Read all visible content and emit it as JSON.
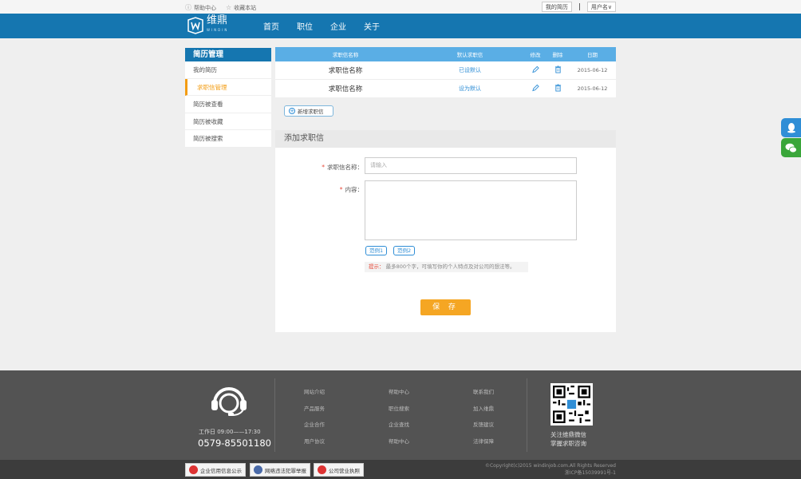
{
  "topbar": {
    "help": "帮助中心",
    "favorite": "收藏本站",
    "my_resume": "我的简历",
    "divider": "|",
    "user_menu": "用户名∨"
  },
  "header": {
    "logo_text": "维鼎",
    "logo_sub": "WINDIN",
    "nav": [
      "首页",
      "职位",
      "企业",
      "关于"
    ]
  },
  "sidebar": {
    "title": "简历管理",
    "items": [
      "我的简历",
      "求职信管理",
      "简历被查看",
      "简历被收藏",
      "简历被搜索"
    ],
    "active_index": 1
  },
  "table": {
    "headers": [
      "求职信名称",
      "默认求职信",
      "修改",
      "删除",
      "日期"
    ],
    "rows": [
      {
        "name": "求职信名称",
        "status": "已设默认",
        "date": "2015-06-12"
      },
      {
        "name": "求职信名称",
        "status": "设为默认",
        "date": "2015-06-12"
      }
    ]
  },
  "add_button": "新增求职信",
  "form": {
    "title": "添加求职信",
    "name_label": "求职信名称：",
    "name_placeholder": "请输入",
    "content_label": "内容：",
    "required_mark": "*",
    "example1": "范例1",
    "example2": "范例2",
    "tip_key": "提示：",
    "tip_text": "最多800个字，可填写你的个人特点及对公司的想法等。",
    "save": "保 存"
  },
  "footer": {
    "work_hours": "工作日  09:00——17:30",
    "phone": "0579-85501180",
    "links": [
      [
        "网站介绍",
        "产品服务",
        "企业合作",
        "用户协议"
      ],
      [
        "帮助中心",
        "职位搜索",
        "企业查找",
        "帮助中心"
      ],
      [
        "联系我们",
        "加入维鼎",
        "反馈建议",
        "法律保障"
      ]
    ],
    "qr_caption_1": "关注维鼎微信",
    "qr_caption_2": "掌握求职咨询",
    "badges": [
      "企业信用信息公示",
      "网络违法犯罪举报",
      "公司营业执照"
    ],
    "copyright": "©Copyright(c)2015 windinjob.com.All Rights Reserved",
    "icp": "浙ICP备15039991号-1"
  },
  "colors": {
    "primary": "#1576b0",
    "accent": "#f5a623",
    "link": "#2f8ed6",
    "footer": "#535353"
  }
}
